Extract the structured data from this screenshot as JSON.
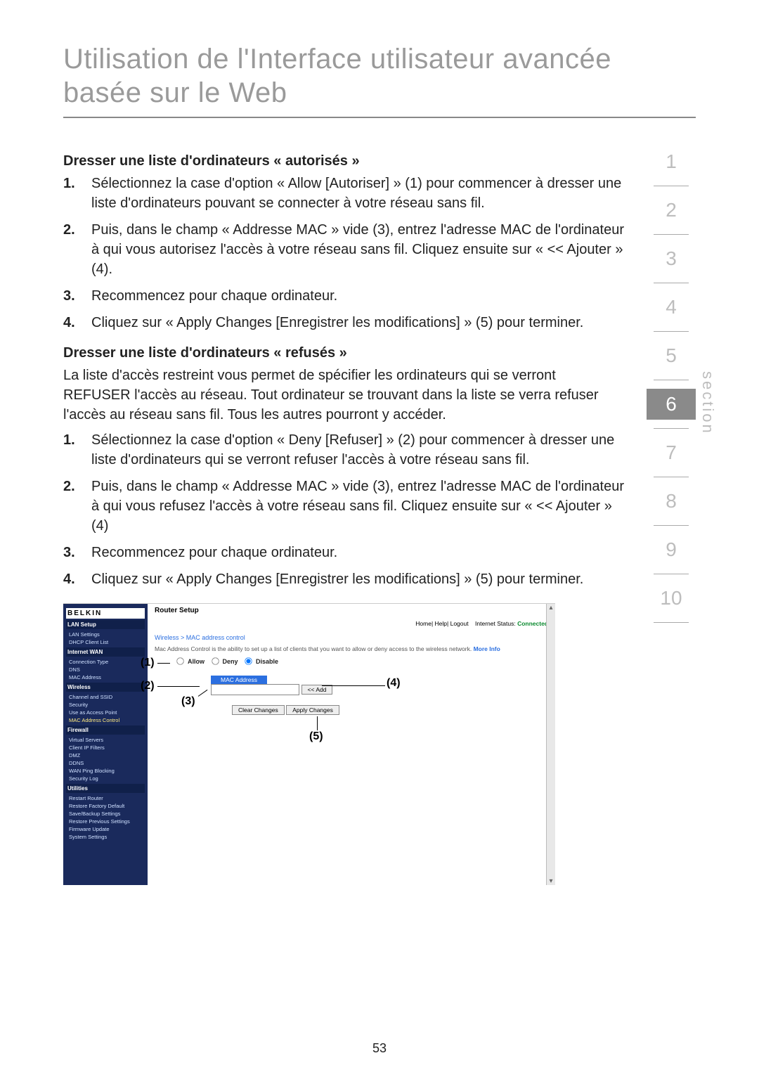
{
  "page_title": "Utilisation de l'Interface utilisateur avancée basée sur le Web",
  "section_label": "section",
  "section_numbers": [
    "1",
    "2",
    "3",
    "4",
    "5",
    "6",
    "7",
    "8",
    "9",
    "10"
  ],
  "active_section": "6",
  "page_number": "53",
  "allowed": {
    "heading": "Dresser une liste d'ordinateurs « autorisés »",
    "steps": [
      "Sélectionnez la case d'option « Allow [Autoriser] » (1) pour commencer à dresser une liste d'ordinateurs pouvant se connecter à votre réseau sans fil.",
      "Puis, dans le champ « Addresse MAC » vide (3), entrez l'adresse MAC de l'ordinateur à qui vous autorisez l'accès à votre réseau sans fil. Cliquez ensuite sur « << Ajouter » (4).",
      "Recommencez pour chaque ordinateur.",
      "Cliquez sur « Apply Changes [Enregistrer les modifications] » (5) pour terminer."
    ]
  },
  "denied": {
    "heading": "Dresser une liste d'ordinateurs « refusés »",
    "intro": "La liste d'accès restreint vous permet de spécifier les ordinateurs qui se verront REFUSER l'accès au réseau. Tout ordinateur se trouvant dans la liste se verra refuser l'accès au réseau sans fil. Tous les autres pourront y accéder.",
    "steps": [
      "Sélectionnez la case d'option « Deny [Refuser] » (2) pour commencer à dresser une liste d'ordinateurs qui se verront refuser l'accès à votre réseau sans fil.",
      "Puis, dans le champ « Addresse MAC » vide (3), entrez l'adresse MAC de l'ordinateur à qui vous refusez l'accès à votre réseau sans fil. Cliquez ensuite sur « << Ajouter » (4)",
      "Recommencez pour chaque ordinateur.",
      "Cliquez sur « Apply Changes [Enregistrer les modifications] » (5) pour terminer."
    ]
  },
  "screenshot": {
    "brand": "BELKIN",
    "router_setup": "Router Setup",
    "top_links": "Home| Help| Logout",
    "status_label": "Internet Status:",
    "status_value": "Connected",
    "breadcrumb": "Wireless > MAC address control",
    "desc": "Mac Address Control is the ability to set up a list of clients that you want to allow or deny access to the wireless network.",
    "more": "More Info",
    "radios": {
      "allow": "Allow",
      "deny": "Deny",
      "disable": "Disable"
    },
    "mac_header": "MAC Address",
    "add_btn": "<< Add",
    "clear_btn": "Clear Changes",
    "apply_btn": "Apply Changes",
    "sidebar": {
      "lan_setup": "LAN Setup",
      "lan_items": [
        "LAN Settings",
        "DHCP Client List"
      ],
      "internet_wan": "Internet WAN",
      "wan_items": [
        "Connection Type",
        "DNS",
        "MAC Address"
      ],
      "wireless": "Wireless",
      "wireless_items": [
        "Channel and SSID",
        "Security",
        "Use as Access Point",
        "MAC Address Control"
      ],
      "firewall": "Firewall",
      "firewall_items": [
        "Virtual Servers",
        "Client IP Filters",
        "DMZ",
        "DDNS",
        "WAN Ping Blocking",
        "Security Log"
      ],
      "utilities": "Utilities",
      "utilities_items": [
        "Restart Router",
        "Restore Factory Default",
        "Save/Backup Settings",
        "Restore Previous Settings",
        "Firmware Update",
        "System Settings"
      ]
    },
    "callouts": {
      "c1": "(1)",
      "c2": "(2)",
      "c3": "(3)",
      "c4": "(4)",
      "c5": "(5)"
    }
  }
}
